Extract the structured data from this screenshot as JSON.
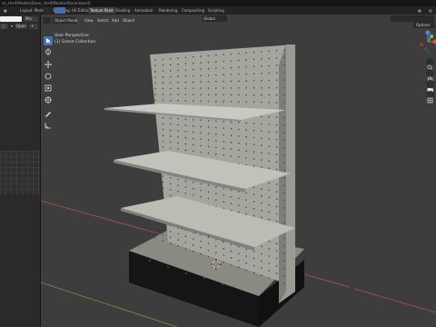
{
  "path_text": "es_shelf/Models/Store_shelf/Models/Stand.blend]",
  "workspace_tabs": [
    {
      "label": "Layout",
      "active": false
    },
    {
      "label": "Modeling",
      "active": false
    },
    {
      "label": "Sculpting",
      "active": false
    },
    {
      "label": "UV Editing",
      "active": false
    },
    {
      "label": "Texture Paint",
      "active": true
    },
    {
      "label": "Shading",
      "active": false
    },
    {
      "label": "Animation",
      "active": false
    },
    {
      "label": "Rendering",
      "active": false
    },
    {
      "label": "Compositing",
      "active": false
    },
    {
      "label": "Scripting",
      "active": false
    }
  ],
  "left_panel": {
    "field_value": "Mix",
    "open_label": "Open"
  },
  "viewport_header": {
    "mode": "Object Mode",
    "menus": [
      "View",
      "Select",
      "Add",
      "Object"
    ],
    "transform_orientation": "Global",
    "options_label": "Options"
  },
  "overlay": {
    "view_name": "User Perspective",
    "collection": "(1) Scene Collection"
  },
  "colors": {
    "viewport_bg": "#3d3d3d",
    "accent": "#4a6fa5",
    "axis_x": "#d9534f",
    "axis_y": "#7cb342",
    "axis_z": "#4f86d9"
  },
  "nav_gizmo": {
    "x": "X",
    "y": "Y",
    "z": "Z"
  },
  "icons": [
    "cursor-icon",
    "move-icon",
    "rotate-icon",
    "scale-icon",
    "transform-icon",
    "annotate-icon",
    "measure-icon",
    "zoom-icon",
    "hand-icon",
    "camera-icon",
    "grid-icon"
  ]
}
